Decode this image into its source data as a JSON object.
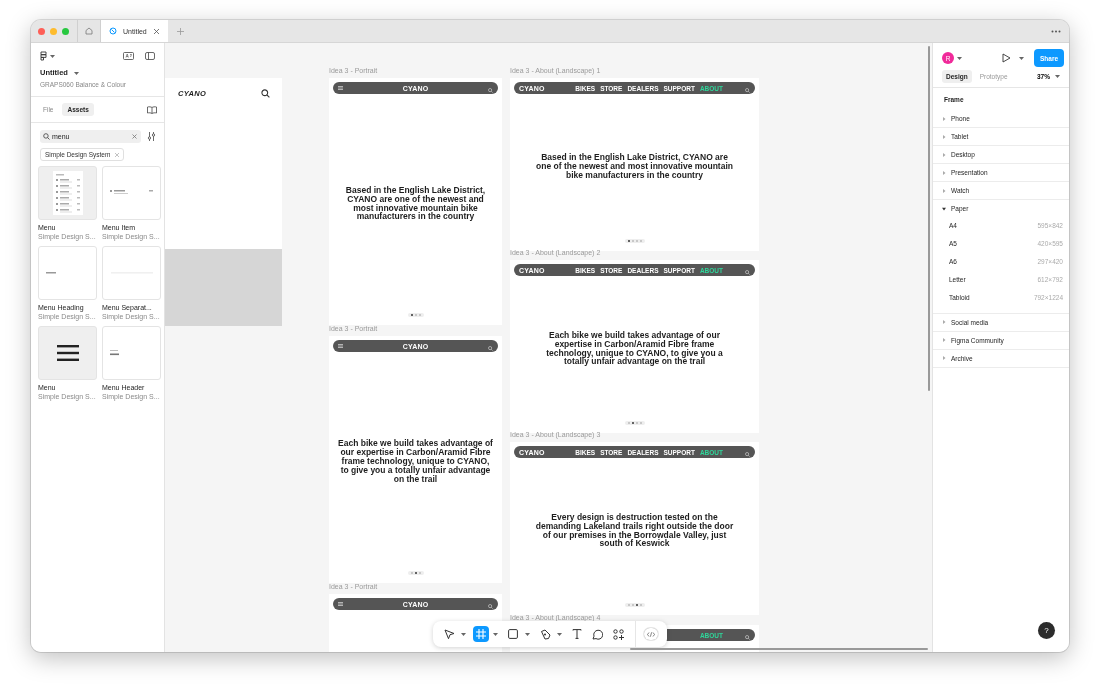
{
  "window": {
    "tabs": [
      {
        "kind": "home",
        "selected": false
      },
      {
        "kind": "file",
        "label": "Untitled",
        "selected": true
      }
    ]
  },
  "left_panel": {
    "file_name": "Untitled",
    "project": "GRAPS060 Balance & Colour",
    "tabs": [
      {
        "label": "File",
        "selected": false
      },
      {
        "label": "Assets",
        "selected": true
      }
    ],
    "search": {
      "value": "menu"
    },
    "filter_chip": "Simple Design System",
    "assets": [
      {
        "kind": "menu-list",
        "name": "Menu",
        "library": "Simple Design S..."
      },
      {
        "kind": "menu-item",
        "name": "Menu Item",
        "library": "Simple Design S..."
      },
      {
        "kind": "heading",
        "name": "Menu Heading",
        "library": "Simple Design S..."
      },
      {
        "kind": "separator",
        "name": "Menu Separat...",
        "library": "Simple Design S..."
      },
      {
        "kind": "hamburger",
        "name": "Menu",
        "library": "Simple Design S..."
      },
      {
        "kind": "header",
        "name": "Menu Header",
        "library": "Simple Design S..."
      }
    ]
  },
  "canvas": {
    "mobile_frame": {
      "logo": "CYANO"
    },
    "frames": [
      {
        "kind": "portrait",
        "label": "Idea 3 - Portrait",
        "nav": {
          "logo": "CYANO"
        },
        "text": "Based in the English Lake District, CYANO are one of the newest and most innovative mountain bike manufacturers in the country",
        "dots": [
          {
            "selected": true
          },
          {
            "selected": false
          },
          {
            "selected": false
          }
        ]
      },
      {
        "kind": "portrait",
        "label": "Idea 3 - Portrait",
        "nav": {
          "logo": "CYANO"
        },
        "text": "Each bike we build takes advantage of our expertise in Carbon/Aramid Fibre frame technology, unique to CYANO, to give you a totally unfair advantage on the trail",
        "dots": [
          {
            "selected": false
          },
          {
            "selected": true
          },
          {
            "selected": false
          }
        ]
      },
      {
        "kind": "portrait",
        "label": "Idea 3 - Portrait",
        "nav": {
          "logo": "CYANO"
        }
      },
      {
        "kind": "landscape",
        "label": "Idea 3 - About (Landscape) 1",
        "nav": {
          "logo": "CYANO",
          "items": [
            {
              "label": "BIKES",
              "selected": false
            },
            {
              "label": "STORE",
              "selected": false
            },
            {
              "label": "DEALERS",
              "selected": false
            },
            {
              "label": "SUPPORT",
              "selected": false
            },
            {
              "label": "ABOUT",
              "selected": true
            }
          ]
        },
        "text": "Based in the English Lake District, CYANO are one of the newest and most innovative mountain bike manufacturers in the country",
        "dots": [
          {
            "selected": true
          },
          {
            "selected": false
          },
          {
            "selected": false
          },
          {
            "selected": false
          }
        ]
      },
      {
        "kind": "landscape",
        "label": "Idea 3 - About (Landscape) 2",
        "nav": {
          "logo": "CYANO",
          "items": [
            {
              "label": "BIKES",
              "selected": false
            },
            {
              "label": "STORE",
              "selected": false
            },
            {
              "label": "DEALERS",
              "selected": false
            },
            {
              "label": "SUPPORT",
              "selected": false
            },
            {
              "label": "ABOUT",
              "selected": true
            }
          ]
        },
        "text": "Each bike we build takes advantage of our expertise in Carbon/Aramid Fibre frame technology, unique to CYANO, to give you a totally unfair advantage on the trail",
        "dots": [
          {
            "selected": false
          },
          {
            "selected": true
          },
          {
            "selected": false
          },
          {
            "selected": false
          }
        ]
      },
      {
        "kind": "landscape",
        "label": "Idea 3 - About (Landscape) 3",
        "nav": {
          "logo": "CYANO",
          "items": [
            {
              "label": "BIKES",
              "selected": false
            },
            {
              "label": "STORE",
              "selected": false
            },
            {
              "label": "DEALERS",
              "selected": false
            },
            {
              "label": "SUPPORT",
              "selected": false
            },
            {
              "label": "ABOUT",
              "selected": true
            }
          ]
        },
        "text": "Every design is destruction tested on the demanding Lakeland trails right outside the door of our premises in the Borrowdale Valley, just south of Keswick",
        "dots": [
          {
            "selected": false
          },
          {
            "selected": false
          },
          {
            "selected": true
          },
          {
            "selected": false
          }
        ]
      },
      {
        "kind": "landscape",
        "label": "Idea 3 - About (Landscape) 4",
        "nav": {
          "items": [
            {
              "label": "ABOUT",
              "selected": true
            }
          ]
        }
      }
    ]
  },
  "toolbar": {
    "tools": [
      {
        "kind": "move",
        "selected": false,
        "menu": true
      },
      {
        "kind": "frame",
        "selected": true,
        "menu": true
      },
      {
        "kind": "shape",
        "selected": false,
        "menu": true
      },
      {
        "kind": "pen",
        "selected": false,
        "menu": true
      },
      {
        "kind": "text",
        "selected": false,
        "menu": false
      },
      {
        "kind": "comment",
        "selected": false,
        "menu": false
      },
      {
        "kind": "actions",
        "selected": false,
        "menu": false
      }
    ],
    "dev_mode": {
      "on": false
    }
  },
  "right_panel": {
    "avatar": "R",
    "share": "Share",
    "tabs": [
      {
        "label": "Design",
        "selected": true
      },
      {
        "label": "Prototype",
        "selected": false
      }
    ],
    "zoom": "37%",
    "heading": "Frame",
    "sections": [
      {
        "label": "Phone",
        "expanded": false
      },
      {
        "label": "Tablet",
        "expanded": false
      },
      {
        "label": "Desktop",
        "expanded": false
      },
      {
        "label": "Presentation",
        "expanded": false
      },
      {
        "label": "Watch",
        "expanded": false
      },
      {
        "label": "Paper",
        "expanded": true,
        "children": [
          {
            "label": "A4",
            "size": "595×842"
          },
          {
            "label": "A5",
            "size": "420×595"
          },
          {
            "label": "A6",
            "size": "297×420"
          },
          {
            "label": "Letter",
            "size": "612×792"
          },
          {
            "label": "Tabloid",
            "size": "792×1224"
          }
        ]
      },
      {
        "label": "Social media",
        "expanded": false
      },
      {
        "label": "Figma Community",
        "expanded": false
      },
      {
        "label": "Archive",
        "expanded": false
      }
    ]
  },
  "help": "?"
}
